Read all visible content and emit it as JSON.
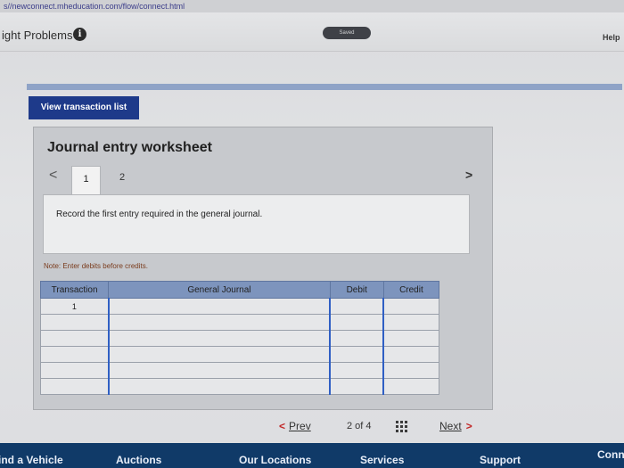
{
  "browser": {
    "url": "s//newconnect.mheducation.com/flow/connect.html"
  },
  "app": {
    "title": "ight Problems",
    "info_icon": "i",
    "saved_label": "Saved",
    "help_label": "Help"
  },
  "actions": {
    "view_transaction_list": "View transaction list"
  },
  "worksheet": {
    "title": "Journal entry worksheet",
    "prev_glyph": "<",
    "next_glyph": ">",
    "tabs": [
      "1",
      "2"
    ],
    "instruction": "Record the first entry required in the general journal.",
    "note": "Note: Enter debits before credits."
  },
  "journal": {
    "headers": [
      "Transaction",
      "General Journal",
      "Debit",
      "Credit"
    ],
    "rows": [
      [
        "1",
        "",
        "",
        ""
      ],
      [
        "",
        "",
        "",
        ""
      ],
      [
        "",
        "",
        "",
        ""
      ],
      [
        "",
        "",
        "",
        ""
      ],
      [
        "",
        "",
        "",
        ""
      ],
      [
        "",
        "",
        "",
        ""
      ]
    ]
  },
  "pager": {
    "prev_label": "Prev",
    "page_status": "2 of 4",
    "next_label": "Next",
    "chevron_left": "<",
    "chevron_right": ">"
  },
  "footer": {
    "items": [
      "ind a Vehicle",
      "Auctions",
      "Our Locations",
      "Services",
      "Support",
      "Conn"
    ]
  }
}
